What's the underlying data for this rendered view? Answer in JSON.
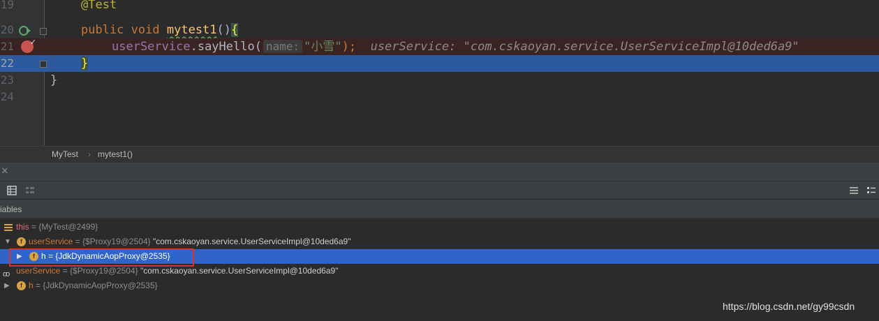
{
  "editor": {
    "lines": [
      {
        "num": "19"
      },
      {
        "num": "20"
      },
      {
        "num": "21"
      },
      {
        "num": "22"
      },
      {
        "num": "23"
      },
      {
        "num": "24"
      }
    ],
    "code": {
      "annotation": "@Test",
      "kw_public": "public",
      "kw_void": "void",
      "method_name": "mytest1",
      "method_parens": "()",
      "open_brace": "{",
      "receiver": "userService",
      "call": ".sayHello(",
      "param_hint": "name:",
      "arg": "\"小雪\"",
      "close_call": ");",
      "inline_value": "userService: \"com.cskaoyan.service.UserServiceImpl@10ded6a9\"",
      "method_close": "}",
      "class_close": "}"
    },
    "gutter_icons": [
      "run-test-icon",
      "breakpoint-icon",
      "fold-icon"
    ]
  },
  "breadcrumb": {
    "items": [
      "MyTest",
      "mytest1()"
    ],
    "separator": "›"
  },
  "tool_window": {
    "close_glyph": "×",
    "variables_title": "iables"
  },
  "variables": {
    "rows": [
      {
        "name": "this",
        "rest": " = {MyTest@2499}"
      },
      {
        "name": "userService",
        "rest": " = {$Proxy19@2504} ",
        "str": "\"com.cskaoyan.service.UserServiceImpl@10ded6a9\""
      },
      {
        "name": "h",
        "rest": " = {JdkDynamicAopProxy@2535}",
        "selected": true
      },
      {
        "name": "userService",
        "rest": " = {$Proxy19@2504} ",
        "str": "\"com.cskaoyan.service.UserServiceImpl@10ded6a9\""
      },
      {
        "name": "h",
        "rest": " = {JdkDynamicAopProxy@2535}"
      }
    ]
  },
  "watermark": "https://blog.csdn.net/gy99csdn",
  "colors": {
    "highlight_box": "#e0302a",
    "selection": "#2f65ca",
    "current_line": "#2d5a9c",
    "breakpoint": "#c75450"
  }
}
